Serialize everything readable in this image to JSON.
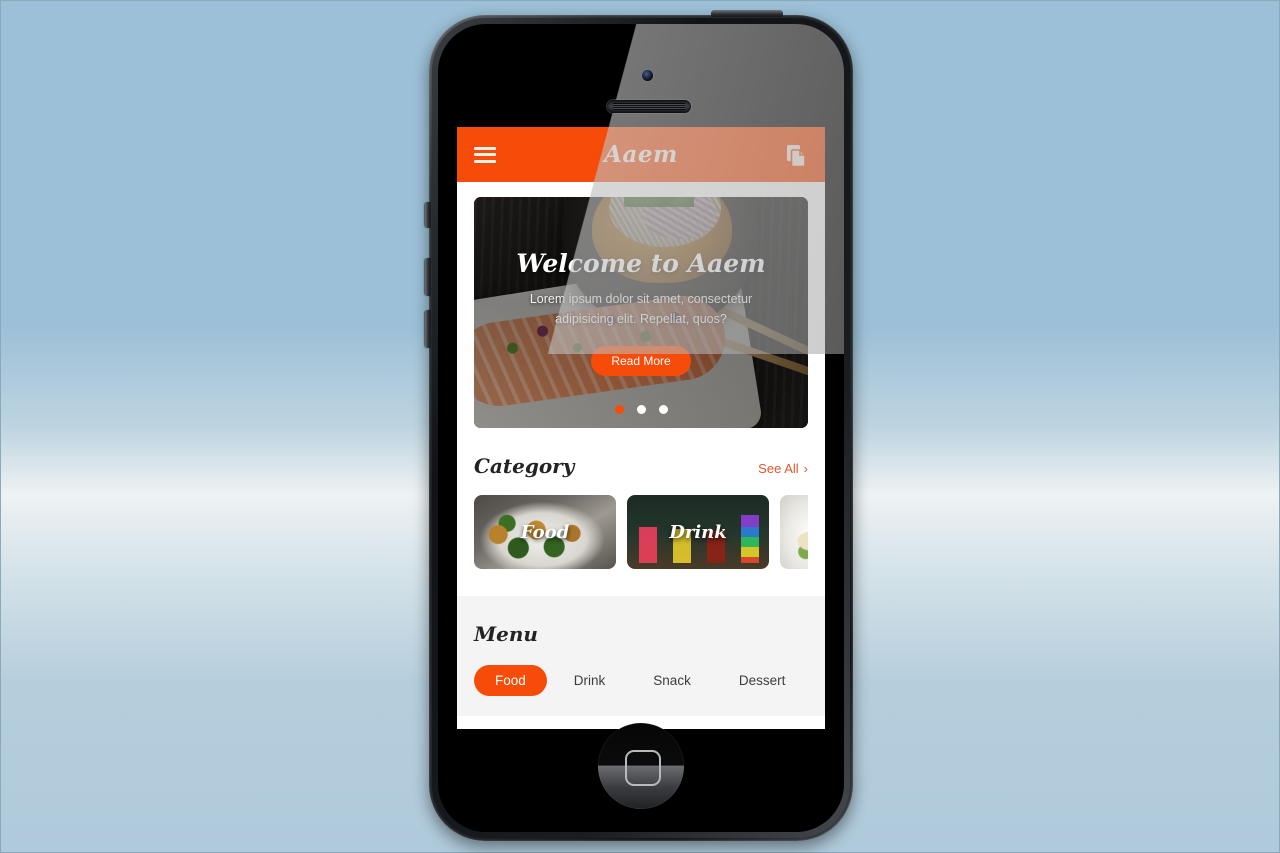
{
  "app": {
    "header": {
      "menu_icon": "hamburger-menu-icon",
      "title": "Aaem",
      "action_icon": "copy-documents-icon"
    },
    "hero": {
      "title": "Welcome to Aaem",
      "subtitle": "Lorem ipsum dolor sit amet, consectetur adipisicing elit. Repellat, quos?",
      "button_label": "Read More",
      "dots": [
        {
          "label": "slide-1",
          "active": true
        },
        {
          "label": "slide-2",
          "active": false
        },
        {
          "label": "slide-3",
          "active": false
        }
      ]
    },
    "category": {
      "title": "Category",
      "see_all_label": "See All",
      "chevron": "›",
      "cards": [
        {
          "label": "Food"
        },
        {
          "label": "Drink"
        },
        {
          "label": ""
        }
      ]
    },
    "menu": {
      "title": "Menu",
      "tabs": [
        {
          "label": "Food",
          "active": true
        },
        {
          "label": "Drink",
          "active": false
        },
        {
          "label": "Snack",
          "active": false
        },
        {
          "label": "Dessert",
          "active": false
        }
      ]
    }
  },
  "device": {
    "camera": "front-camera",
    "speaker": "earpiece-speaker",
    "home_button": "home-button",
    "buttons": [
      "mute-switch",
      "volume-up-button",
      "volume-down-button",
      "power-button"
    ]
  },
  "colors": {
    "accent": "#f74c09",
    "see_all": "#e1572d",
    "menu_bg": "#f4f4f4",
    "screen_bg": "#ffffff",
    "page_bg_top": "#9cc0d7",
    "page_bg_mid": "#eef2f3",
    "page_bg_bottom": "#afcadb"
  }
}
